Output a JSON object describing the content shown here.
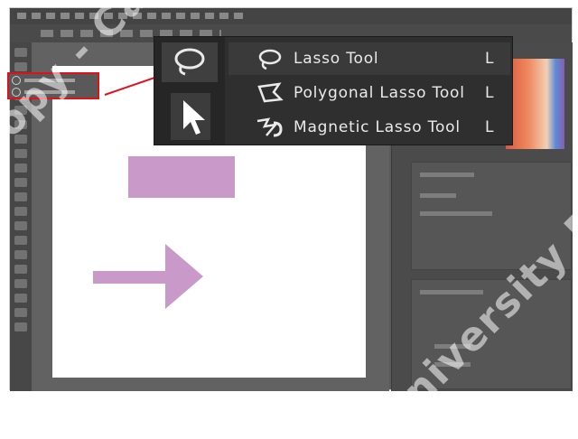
{
  "tool_menu": {
    "items": [
      {
        "label": "Lasso Tool",
        "shortcut": "L",
        "icon": "lasso-icon"
      },
      {
        "label": "Polygonal Lasso Tool",
        "shortcut": "L",
        "icon": "polygonal-lasso-icon"
      },
      {
        "label": "Magnetic Lasso Tool",
        "shortcut": "L",
        "icon": "magnetic-lasso-icon"
      }
    ]
  },
  "colors": {
    "callout": "#e3101c",
    "shape_fill": "#c899c9",
    "app_bg": "#5a5a5a",
    "menu_bg": "#2f2f2f"
  },
  "watermark": {
    "line1": "Copy - Cambridge",
    "line2": "University Press"
  }
}
